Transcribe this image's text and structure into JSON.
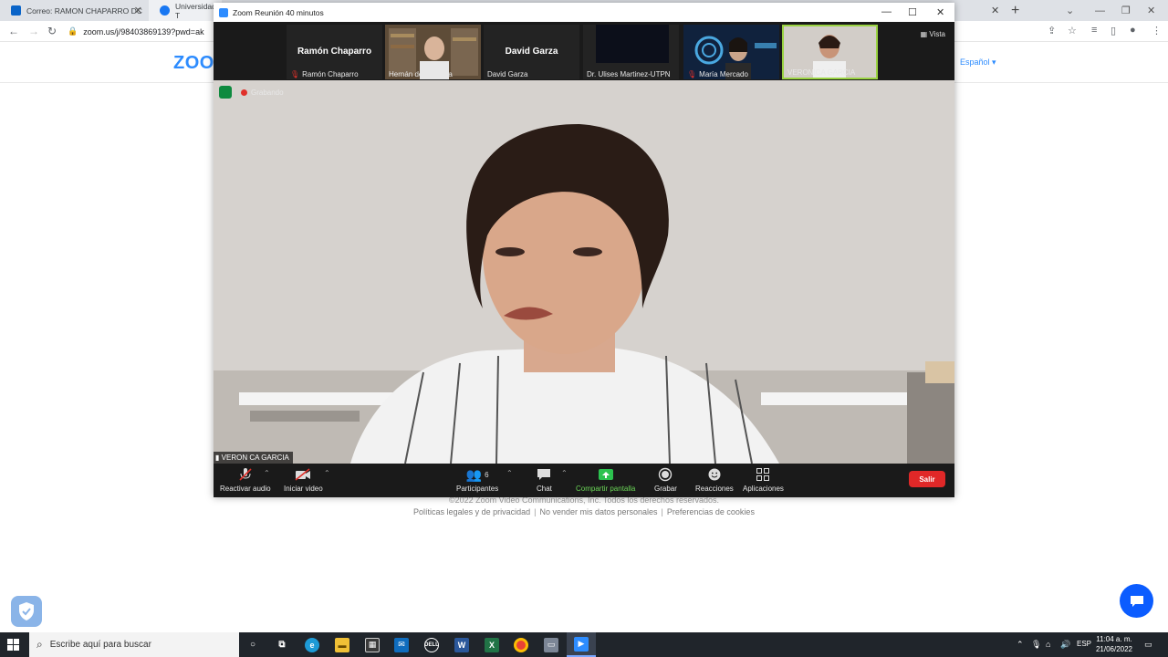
{
  "browser": {
    "tabs": [
      {
        "label": "Correo: RAMON CHAPARRO DC",
        "favicon_color": "#0a64c8"
      },
      {
        "label": "Universidad T",
        "favicon_color": "#1877f2"
      }
    ],
    "url": "zoom.us/j/98403869139?pwd=ak"
  },
  "page": {
    "logo": "ZOO",
    "language": "Español",
    "copyright": "©2022 Zoom Video Communications, Inc. Todos los derechos reservados.",
    "links": [
      "Políticas legales y de privacidad",
      "No vender mis datos personales",
      "Preferencias de cookies"
    ]
  },
  "zoom": {
    "title": "Zoom Reunión 40 minutos",
    "view_label": "Vista",
    "recording_label": "Grabando",
    "active_speaker": "VERON CA GARCIA",
    "participants": [
      {
        "caption": "Ramón Chaparro",
        "display": "Ramón Chaparro",
        "muted": true
      },
      {
        "caption": "Hernán de la Garza",
        "display": "",
        "muted": false
      },
      {
        "caption": "David Garza",
        "display": "David Garza",
        "muted": false
      },
      {
        "caption": "Dr. Ulises Martinez-UTPN",
        "display": "",
        "muted": false
      },
      {
        "caption": "María Mercado",
        "display": "",
        "muted": true
      },
      {
        "caption": "VERONICA GARCIA",
        "display": "",
        "muted": false
      }
    ],
    "controls": {
      "audio": "Reactivar audio",
      "video": "Iniciar video",
      "participants": "Participantes",
      "participants_count": "6",
      "chat": "Chat",
      "share": "Compartir pantalla",
      "record": "Grabar",
      "reactions": "Reacciones",
      "apps": "Aplicaciones",
      "leave": "Salir"
    }
  },
  "taskbar": {
    "search_placeholder": "Escribe aquí para buscar",
    "language": "ESP",
    "time": "11:04 a. m.",
    "date": "21/06/2022"
  }
}
